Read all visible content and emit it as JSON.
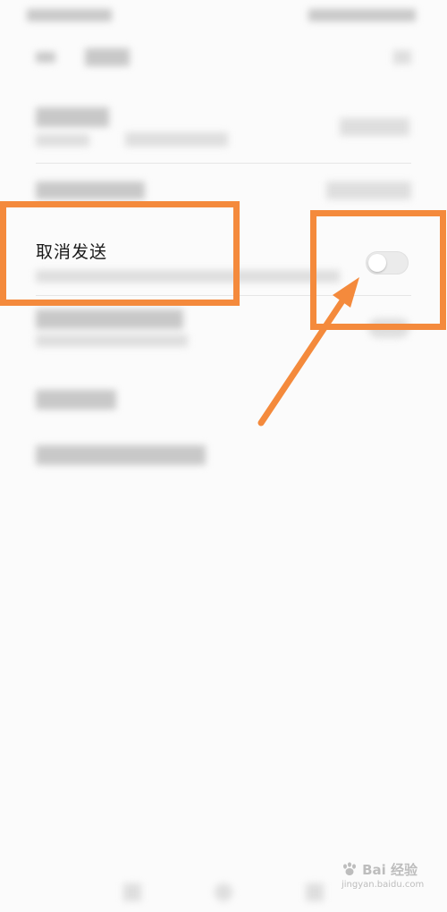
{
  "setting": {
    "title": "取消发送",
    "toggle_on": false
  },
  "colors": {
    "highlight": "#f48a3c",
    "toggle_off": "#ebebeb"
  },
  "watermark": {
    "brand": "Bai 经验",
    "url": "jingyan.baidu.com"
  },
  "icons": [
    "back-arrow-icon",
    "paw-icon"
  ]
}
